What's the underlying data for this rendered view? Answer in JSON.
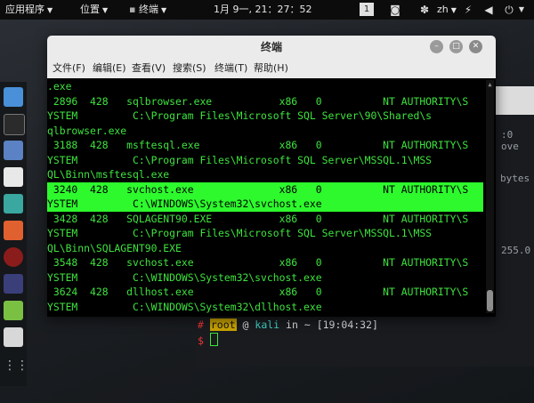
{
  "topbar": {
    "apps_label": "应用程序",
    "places_label": "位置",
    "active_app_label": "终端",
    "clock": "1月 9一, 21：27：52",
    "workspace": "1",
    "lang": "zh"
  },
  "window": {
    "title": "终端",
    "menus": [
      "文件(F)",
      "编辑(E)",
      "查看(V)",
      "搜索(S)",
      "终端(T)",
      "帮助(H)"
    ]
  },
  "terminal_lines": [
    ".exe",
    " 2896  428   sqlbrowser.exe           x86   0          NT AUTHORITY\\S",
    "YSTEM         C:\\Program Files\\Microsoft SQL Server\\90\\Shared\\s",
    "qlbrowser.exe",
    " 3188  428   msftesql.exe             x86   0          NT AUTHORITY\\S",
    "YSTEM         C:\\Program Files\\Microsoft SQL Server\\MSSQL.1\\MSS",
    "QL\\Binn\\msftesql.exe",
    " 3240  428   svchost.exe              x86   0          NT AUTHORITY\\S",
    "YSTEM         C:\\WINDOWS\\System32\\svchost.exe",
    " 3428  428   SQLAGENT90.EXE           x86   0          NT AUTHORITY\\S",
    "YSTEM         C:\\Program Files\\Microsoft SQL Server\\MSSQL.1\\MSS",
    "QL\\Binn\\SQLAGENT90.EXE",
    " 3548  428   svchost.exe              x86   0          NT AUTHORITY\\S",
    "YSTEM         C:\\WINDOWS\\System32\\svchost.exe",
    " 3624  428   dllhost.exe              x86   0          NT AUTHORITY\\S",
    "YSTEM         C:\\WINDOWS\\System32\\dllhost.exe"
  ],
  "highlight_rows": [
    7,
    8
  ],
  "background_terminal": {
    "right_fragments": [
      ":0 ove",
      "bytes",
      "255.0"
    ],
    "prompt_hash": "#",
    "prompt_user": "root",
    "prompt_at": "@",
    "prompt_host": "kali",
    "prompt_in": "in",
    "prompt_dir": "~",
    "prompt_time": "[19:04:32]",
    "prompt_symbol": "$"
  },
  "colors": {
    "terminal_text": "#3ee33e",
    "highlight_bg": "#2df92d",
    "prompt_user_bg": "#c8a200",
    "prompt_host": "#3fd7c7"
  }
}
